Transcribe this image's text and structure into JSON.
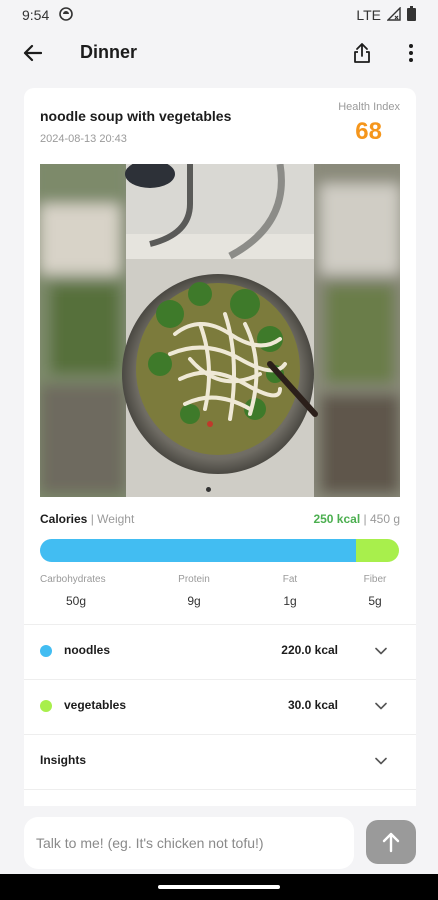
{
  "status_bar": {
    "time": "9:54",
    "network": "LTE"
  },
  "app_bar": {
    "title": "Dinner"
  },
  "meal": {
    "name": "noodle soup with vegetables",
    "datetime": "2024-08-13 20:43",
    "health_index_label": "Health Index",
    "health_index_value": "68"
  },
  "nutrition": {
    "calories_label": "Calories",
    "separator": "|",
    "weight_label": "Weight",
    "calories_value": "250 kcal",
    "weight_value": "450 g",
    "calorie_split": [
      {
        "name": "noodles",
        "kcal": 220.0,
        "color": "#42bdf2"
      },
      {
        "name": "vegetables",
        "kcal": 30.0,
        "color": "#a8ef4c"
      }
    ],
    "macros": [
      {
        "label": "Carbohydrates",
        "value": "50g"
      },
      {
        "label": "Protein",
        "value": "9g"
      },
      {
        "label": "Fat",
        "value": "1g"
      },
      {
        "label": "Fiber",
        "value": "5g"
      }
    ]
  },
  "items": [
    {
      "name": "noodles",
      "kcal": "220.0 kcal",
      "color": "#42bdf2"
    },
    {
      "name": "vegetables",
      "kcal": "30.0 kcal",
      "color": "#a8ef4c"
    }
  ],
  "insights": {
    "label": "Insights"
  },
  "chat": {
    "placeholder": "Talk to me! (eg. It's chicken not tofu!)"
  },
  "colors": {
    "health_index": "#f5961c",
    "calories_green": "#4caf50",
    "send_button": "#9a9a9a"
  }
}
